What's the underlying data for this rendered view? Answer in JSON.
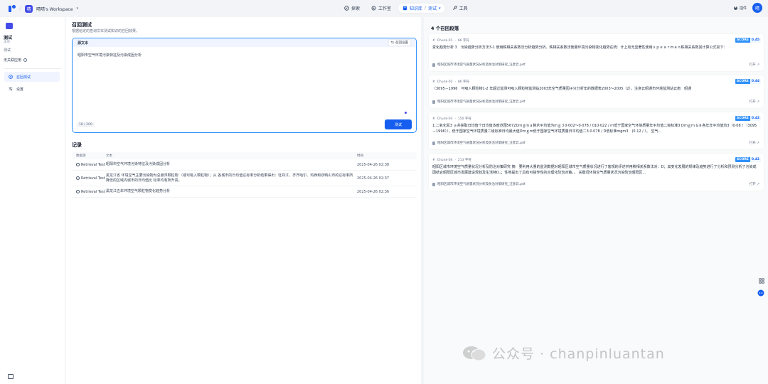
{
  "topnav": {
    "workspace_initial": "晴",
    "workspace_name": "晴晴's Workspace",
    "workspace_chevron": "▾",
    "items": [
      {
        "label": "探索",
        "icon": "compass-icon"
      },
      {
        "label": "工作室",
        "icon": "grid-icon"
      },
      {
        "label": "知识库",
        "icon": "book-icon",
        "sub": "测试"
      },
      {
        "label": "工具",
        "icon": "tool-icon"
      }
    ],
    "plugin_label": "插件",
    "user_initial": "晴"
  },
  "sidebar": {
    "title": "测试",
    "subtitle": "本地",
    "description": "测试",
    "unrelated_label": "无关联应用",
    "menu": [
      {
        "label": "召回测试",
        "icon": "target-icon",
        "active": true
      },
      {
        "label": "设置",
        "icon": "settings-icon",
        "active": false
      }
    ]
  },
  "main": {
    "title": "召回测试",
    "subtitle": "根据给定的查询文本测试知识的召回效果。",
    "source": {
      "label": "源文本",
      "settings_label": "召回设置",
      "text": "昭阳市空气环境污染特征及污染成因分析",
      "char_count": "18 / 200",
      "test_button": "测试"
    },
    "records": {
      "title": "记录",
      "columns": [
        "数据源",
        "文本",
        "时间"
      ],
      "rows": [
        {
          "source": "Retrieval Test",
          "text": "昭阳市空气环境污染特征及污染成因分析",
          "time": "2025-04-26 02:38"
        },
        {
          "source": "Retrieval Test",
          "text": "黑龙江省 环境空气主要污染物为总悬浮颗粒物 （或可吸入颗粒物）；从 各城市的日均值达标率分析结果得出：牡丹江、齐齐哈尔、鸡西和双鸭山市的达标率所降低的区域内城市的日均值比 标率均有所升高。",
          "time": "2025-04-26 02:37"
        },
        {
          "source": "Retrieval Test",
          "text": "黑龙江五年环境空气颗粒物变化趋势分析",
          "time": "2025-04-26 02:36"
        }
      ]
    }
  },
  "results": {
    "title": "4 个召回段落",
    "open_label": "打开 ↗",
    "chunks": [
      {
        "id": "Chunk-01",
        "chars": "66 字符",
        "score_label": "SCORE",
        "score": "0.45",
        "text": "变化趋势分析 3　污染趋势分析方法3-1 使用秩相关系数法分析趋势分析。秩相关系数法衡量环境污染物变化趋势在统：计上有无显著性使用ｓｐｅａｒｍａｎ秩相关系数其计算公式如下：",
        "doc": "昭阳区城市环境空气质量状况分析及防治对策研究_汪彦云.pdf"
      },
      {
        "id": "Chunk-02",
        "chars": "86 字符",
        "score_label": "SCORE",
        "score": "0.44",
        "text": "（3095－1996　可吸入颗粒物1-2 年超过监测可吸入颗粒物监测站2003年空气质量因子只分析年的数据表2003～2005（2）。注意云昭通市环境监测站云南　昭通",
        "doc": "昭阳区城市环境空气质量状况分析及防治对策研究_汪彦云.pdf"
      },
      {
        "id": "Chunk-03",
        "chars": "150 字符",
        "score_label": "SCORE",
        "score": "0.42",
        "text": "1:二氧化氮3 ａ共获取日均值个日均值浓度范围5672Dｍｇｍａ算术平均值为ｍｇ３0·002～0·078 / 010·022 / ｍ低于国家空气环境质量年平均值二级标准3 Dｍｇｍ G８各年年平均值均3（0·08 / （3095－1996））。低于国家空气环境质量二级标准日均最大值Dｍｇｍ低于国家空气环境质量日平均值二3·0·078 / D低标准mgm3　(0·12 / ）。 空气...",
        "doc": "昭阳区城市环境空气质量状况分析及防治对策研究_汪彦云.pdf"
      },
      {
        "id": "Chunk-04",
        "chars": "213 字符",
        "score_label": "SCORE",
        "score": "0.42",
        "text": "昭阳区城市环境空气质量状况分析及防治对策研究 摘　要利用大量的监测数据对昭阳区城市空气质量状况进行了客观的评述并用秩相关系数法对：D；其变化发展的规律及趋势进行了分析和预测分析了污染成因结合昭阳区城市发展建设规划及生活特D，；性地提出了具有可操作性的合理化防治对策。。 关键词环境空气质量状况污染防治昭阳区...",
        "doc": "昭阳区城市环境空气质量状况分析及防治对策研究_汪彦云.pdf"
      }
    ]
  },
  "watermark": {
    "text": "公众号 · chanpinluantan"
  },
  "colors": {
    "accent": "#155eef",
    "score_bg": "#2e90fa",
    "workspace_avatar": "#444ce7"
  }
}
